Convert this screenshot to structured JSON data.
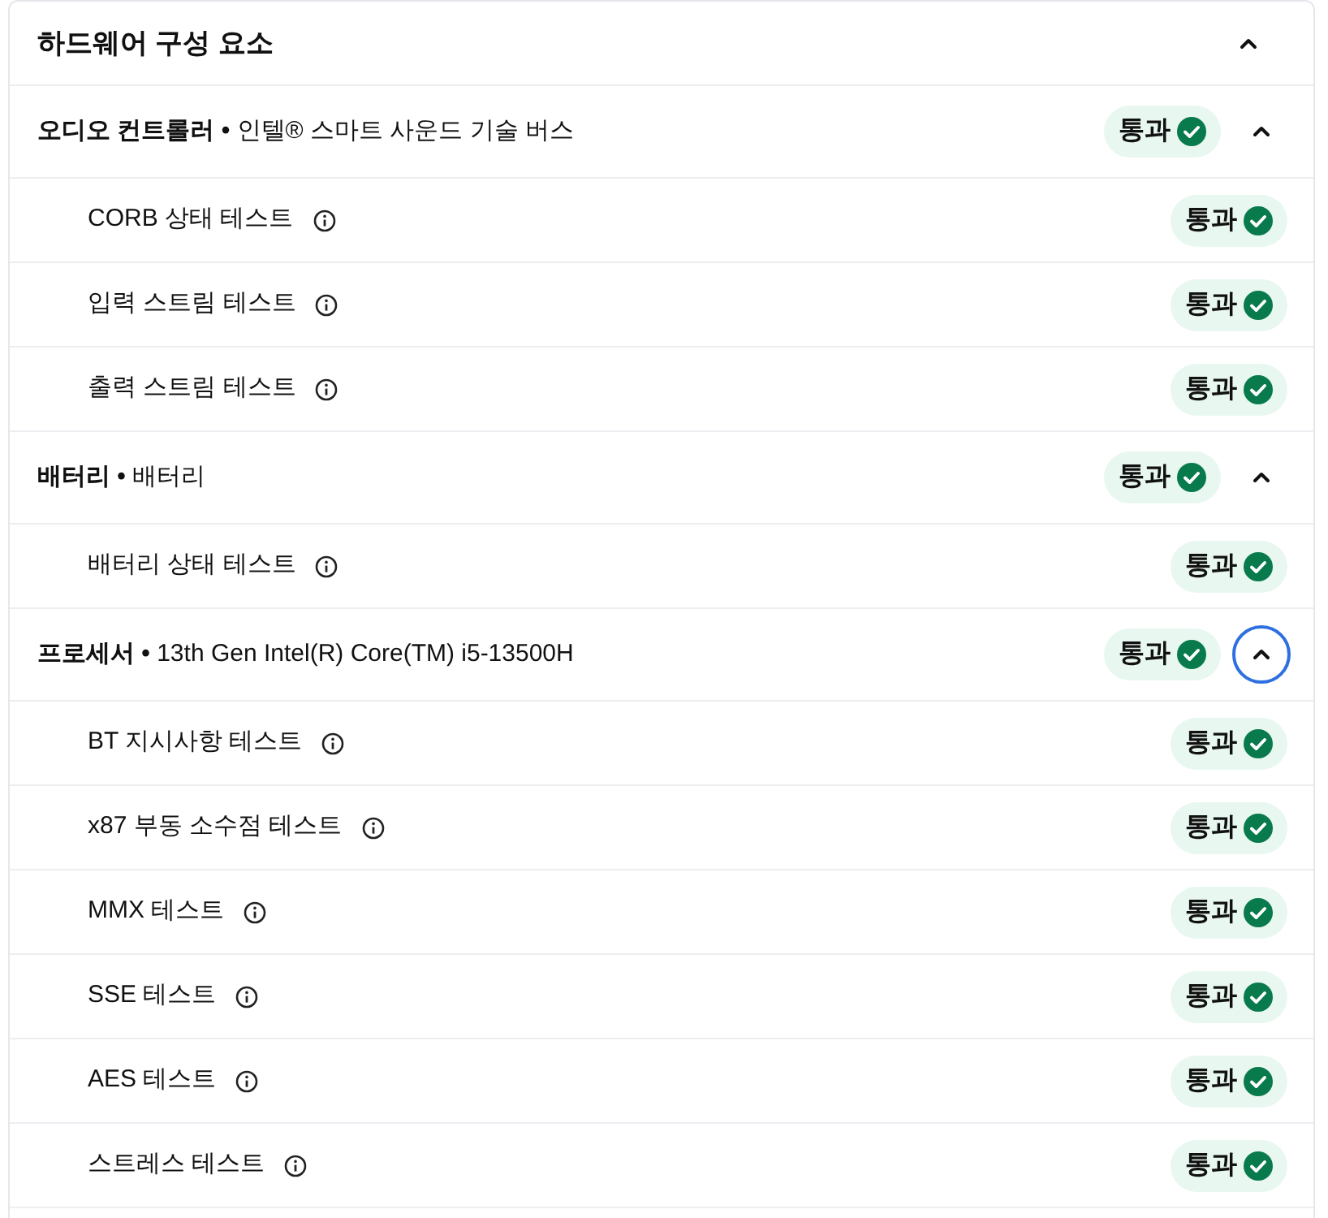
{
  "section": {
    "title": "하드웨어 구성 요소",
    "expanded": true
  },
  "groups": [
    {
      "title": "**오디오 컨트롤러 •** 인텔® 스마트 사운드 기술 버스",
      "status": {
        "kind": "pass",
        "label": "통과"
      },
      "expanded": true,
      "focused": false,
      "tests": [
        {
          "name": "CORB 상태 테스트",
          "status": {
            "kind": "pass",
            "label": "통과"
          }
        },
        {
          "name": "입력 스트림 테스트",
          "status": {
            "kind": "pass",
            "label": "통과"
          }
        },
        {
          "name": "출력 스트림 테스트",
          "status": {
            "kind": "pass",
            "label": "통과"
          }
        }
      ]
    },
    {
      "title": "**배터리 •** 배터리",
      "status": {
        "kind": "pass",
        "label": "통과"
      },
      "expanded": true,
      "focused": false,
      "tests": [
        {
          "name": "배터리 상태 테스트",
          "status": {
            "kind": "pass",
            "label": "통과"
          }
        }
      ]
    },
    {
      "title": "**프로세서 •** 13th Gen Intel(R) Core(TM) i5-13500H",
      "status": {
        "kind": "pass",
        "label": "통과"
      },
      "expanded": true,
      "focused": true,
      "tests": [
        {
          "name": "BT 지시사항 테스트",
          "status": {
            "kind": "pass",
            "label": "통과"
          }
        },
        {
          "name": "x87 부동 소수점 테스트",
          "status": {
            "kind": "pass",
            "label": "통과"
          }
        },
        {
          "name": "MMX 테스트",
          "status": {
            "kind": "pass",
            "label": "통과"
          }
        },
        {
          "name": "SSE 테스트",
          "status": {
            "kind": "pass",
            "label": "통과"
          }
        },
        {
          "name": "AES 테스트",
          "status": {
            "kind": "pass",
            "label": "통과"
          }
        },
        {
          "name": "스트레스 테스트",
          "status": {
            "kind": "pass",
            "label": "통과"
          }
        }
      ]
    }
  ]
}
